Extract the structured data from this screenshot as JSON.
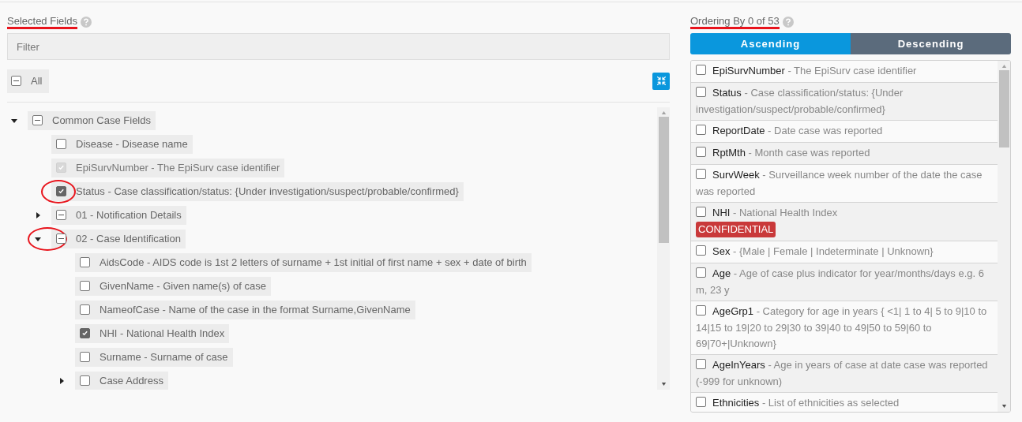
{
  "selected_fields": {
    "title": "Selected Fields",
    "annotated": true,
    "filter": {
      "placeholder": "Filter"
    },
    "all": {
      "label": "All",
      "checked": false,
      "mixed": true
    },
    "tree": [
      {
        "label": "Common Case Fields",
        "checked": false,
        "mixed": true,
        "expanded": true,
        "annotated": false,
        "children": [
          {
            "label": "Disease - Disease name",
            "checked": false,
            "disabled": false,
            "annotated": false
          },
          {
            "label": "EpiSurvNumber - The EpiSurv case identifier",
            "checked": true,
            "disabled": true,
            "annotated": false
          },
          {
            "label": "Status - Case classification/status: {Under investigation/suspect/probable/confirmed}",
            "checked": true,
            "disabled": false,
            "annotated": true
          },
          {
            "label": "01 - Notification Details",
            "checked": false,
            "mixed": true,
            "expanded": false,
            "annotated": false
          },
          {
            "label": "02 - Case Identification",
            "checked": false,
            "mixed": true,
            "expanded": true,
            "annotated": true,
            "children": [
              {
                "label": "AidsCode - AIDS code is 1st 2 letters of surname + 1st initial of first name + sex + date of birth",
                "checked": false,
                "disabled": false,
                "annotated": false
              },
              {
                "label": "GivenName - Given name(s) of case",
                "checked": false,
                "disabled": false,
                "annotated": false
              },
              {
                "label": "NameofCase - Name of the case in the format Surname,GivenName",
                "checked": false,
                "disabled": false,
                "annotated": false
              },
              {
                "label": "NHI - National Health Index",
                "checked": true,
                "disabled": false,
                "annotated": false
              },
              {
                "label": "Surname - Surname of case",
                "checked": false,
                "disabled": false,
                "annotated": false
              },
              {
                "label": "Case Address",
                "checked": false,
                "mixed": false,
                "expanded": false,
                "annotated": false
              }
            ]
          }
        ]
      }
    ]
  },
  "ordering": {
    "title": "Ordering By 0 of 53",
    "annotated": true,
    "directions": [
      {
        "label": "Ascending",
        "selected": true
      },
      {
        "label": "Descending",
        "selected": false
      }
    ],
    "fields": [
      {
        "name": "EpiSurvNumber",
        "description": "- The EpiSurv case identifier",
        "checked": false
      },
      {
        "name": "Status",
        "description": "- Case classification/status: {Under investigation/suspect/probable/confirmed}",
        "checked": false
      },
      {
        "name": "ReportDate",
        "description": "- Date case was reported",
        "checked": false
      },
      {
        "name": "RptMth",
        "description": "- Month case was reported",
        "checked": false
      },
      {
        "name": "SurvWeek",
        "description": "- Surveillance week number of the date the case was reported",
        "checked": false
      },
      {
        "name": "NHI",
        "description": "- National Health Index",
        "checked": false,
        "badge": "CONFIDENTIAL"
      },
      {
        "name": "Sex",
        "description": "- {Male | Female | Indeterminate | Unknown}",
        "checked": false
      },
      {
        "name": "Age",
        "description": "- Age of case plus indicator for year/months/days e.g. 6 m, 23 y",
        "checked": false
      },
      {
        "name": "AgeGrp1",
        "description": "- Category for age in years { <1| 1 to 4| 5 to 9|10 to 14|15 to 19|20 to 29|30 to 39|40 to 49|50 to 59|60 to 69|70+|Unknown}",
        "checked": false
      },
      {
        "name": "AgeInYears",
        "description": "- Age in years of case at date case was reported (-999 for unknown)",
        "checked": false
      },
      {
        "name": "Ethnicities",
        "description": "- List of ethnicities as selected",
        "checked": false
      }
    ]
  }
}
